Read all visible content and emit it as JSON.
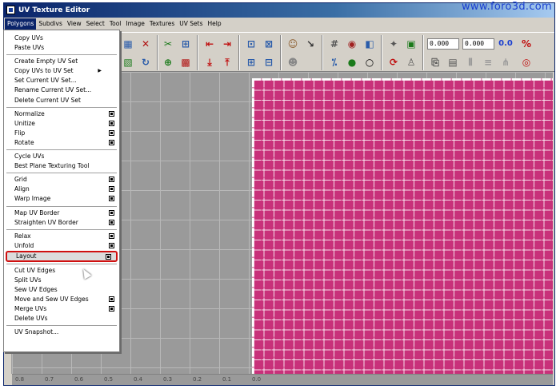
{
  "window": {
    "title": "UV Texture Editor"
  },
  "watermark": "www.foro3d.com",
  "menubar": [
    "Polygons",
    "Subdivs",
    "View",
    "Select",
    "Tool",
    "Image",
    "Textures",
    "UV Sets",
    "Help"
  ],
  "active_menu": "Polygons",
  "toolbar": {
    "field_u": "0.000",
    "field_v": "0.000",
    "readout": "0.0"
  },
  "dropdown": {
    "groups": [
      [
        {
          "label": "Copy UVs"
        },
        {
          "label": "Paste UVs"
        }
      ],
      [
        {
          "label": "Create Empty UV Set"
        },
        {
          "label": "Copy UVs to UV Set",
          "submenu": true
        },
        {
          "label": "Set Current UV Set..."
        },
        {
          "label": "Rename Current UV Set..."
        },
        {
          "label": "Delete Current UV Set"
        }
      ],
      [
        {
          "label": "Normalize",
          "options": true
        },
        {
          "label": "Unitize",
          "options": true
        },
        {
          "label": "Flip",
          "options": true
        },
        {
          "label": "Rotate",
          "options": true
        }
      ],
      [
        {
          "label": "Cycle UVs"
        },
        {
          "label": "Best Plane Texturing Tool"
        }
      ],
      [
        {
          "label": "Grid",
          "options": true
        },
        {
          "label": "Align",
          "options": true
        },
        {
          "label": "Warp Image",
          "options": true
        }
      ],
      [
        {
          "label": "Map UV Border",
          "options": true
        },
        {
          "label": "Straighten UV Border",
          "options": true
        }
      ],
      [
        {
          "label": "Relax",
          "options": true
        },
        {
          "label": "Unfold",
          "options": true
        },
        {
          "label": "Layout",
          "options": true,
          "highlighted": true
        }
      ],
      [
        {
          "label": "Cut UV Edges"
        },
        {
          "label": "Split UVs"
        },
        {
          "label": "Sew UV Edges"
        },
        {
          "label": "Move and Sew UV Edges",
          "options": true
        },
        {
          "label": "Merge UVs",
          "options": true
        },
        {
          "label": "Delete UVs"
        }
      ],
      [
        {
          "label": "UV Snapshot..."
        }
      ]
    ]
  },
  "ruler_ticks": [
    "0.8",
    "0.7",
    "0.6",
    "0.5",
    "0.4",
    "0.3",
    "0.2",
    "0.1",
    "0.0"
  ],
  "colors": {
    "uv_tile": "#c8317a",
    "highlight_border": "#d01010",
    "titlebar": "#0a246a"
  }
}
